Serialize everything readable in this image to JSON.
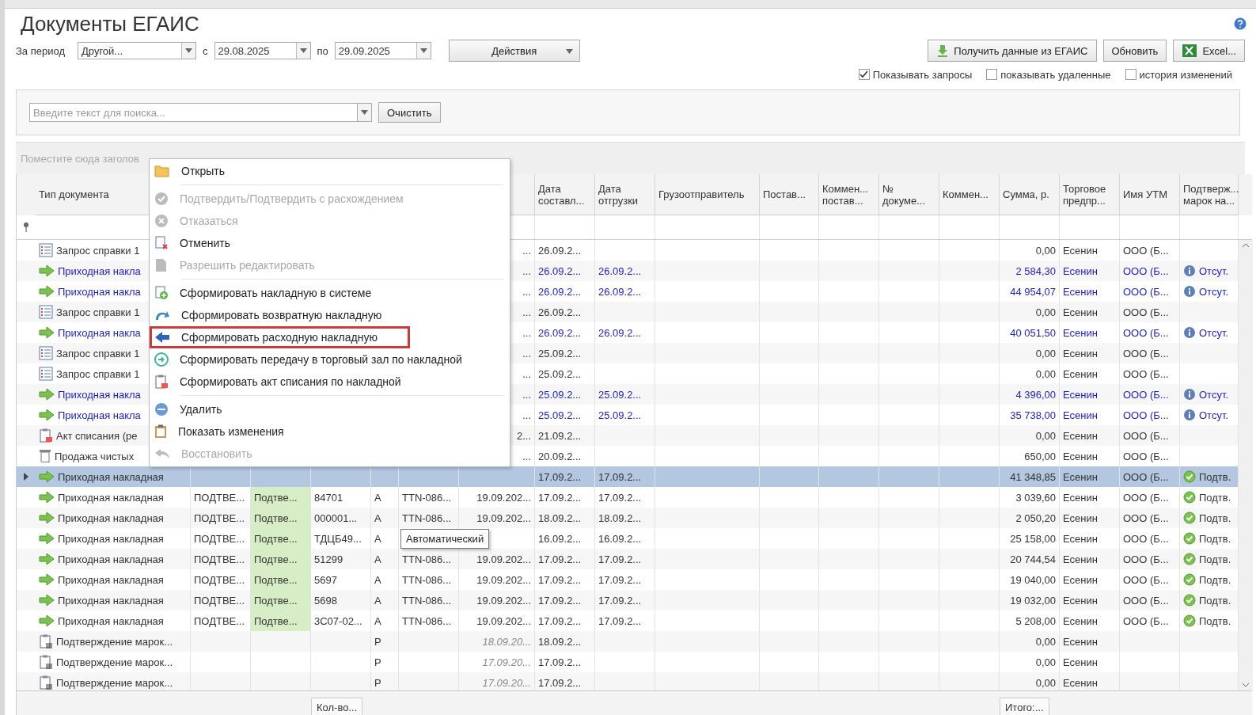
{
  "title": "Документы ЕГАИС",
  "filters": {
    "period_label": "За период",
    "period": "Другой...",
    "from_label": "с",
    "from": "29.08.2025",
    "to_label": "по",
    "to": "29.09.2025",
    "actions": "Действия"
  },
  "buttons": [
    {
      "kind": "egais",
      "label": "Получить данные из ЕГАИС"
    },
    {
      "kind": "plain",
      "label": "Обновить"
    },
    {
      "kind": "excel",
      "label": "Excel..."
    }
  ],
  "options": [
    {
      "label": "Показывать запросы",
      "checked": true
    },
    {
      "label": "показывать удаленные",
      "checked": false
    },
    {
      "label": "история изменений",
      "checked": false
    }
  ],
  "search": {
    "placeholder": "Введите текст для поиска...",
    "clear": "Очистить"
  },
  "group_panel": "Поместите сюда заголов",
  "table": {
    "columns": {
      "type": "Тип документа",
      "date_made": "Дата составл...",
      "date_shipped": "Дата отгрузки",
      "shipper": "Грузоотправитель",
      "supplier": "Постав...",
      "supplier_comment": "Коммен... постав...",
      "doc_number": "№ докуме...",
      "comment": "Коммен...",
      "sum": "Сумма, р.",
      "trade": "Торговое предпр...",
      "utm": "Имя УТМ",
      "marks": "Подтверж... марок на..."
    },
    "rows": [
      {
        "kind": "request",
        "color": "#333333",
        "selected": false,
        "cells": {
          "type": "Запрос справки 1",
          "column_8": "...",
          "date_made": "26.09.2...",
          "sum": "0,00",
          "trade": "Есенин",
          "utm": "ООО (Б..."
        }
      },
      {
        "kind": "incoming",
        "color": "#1c1ccc",
        "selected": false,
        "cells": {
          "type": "Приходная накла",
          "column_8": "...",
          "date_made": "26.09.2...",
          "date_shipped": "26.09.2...",
          "sum": "2 584,30",
          "trade": "Есенин",
          "utm": "ООО (Б..."
        },
        "confirm": {
          "kind": "info",
          "text": "Отсут."
        }
      },
      {
        "kind": "incoming",
        "color": "#1c1ccc",
        "selected": false,
        "cells": {
          "type": "Приходная накла",
          "column_8": "...",
          "date_made": "26.09.2...",
          "date_shipped": "26.09.2...",
          "sum": "44 954,07",
          "trade": "Есенин",
          "utm": "ООО (Б..."
        },
        "confirm": {
          "kind": "info",
          "text": "Отсут."
        }
      },
      {
        "kind": "request",
        "color": "#333333",
        "selected": false,
        "cells": {
          "type": "Запрос справки 1",
          "column_8": "...",
          "date_made": "26.09.2...",
          "sum": "0,00",
          "trade": "Есенин",
          "utm": "ООО (Б..."
        }
      },
      {
        "kind": "incoming",
        "color": "#1c1ccc",
        "selected": false,
        "cells": {
          "type": "Приходная накла",
          "column_8": "...",
          "date_made": "26.09.2...",
          "date_shipped": "26.09.2...",
          "sum": "40 051,50",
          "trade": "Есенин",
          "utm": "ООО (Б..."
        },
        "confirm": {
          "kind": "info",
          "text": "Отсут."
        }
      },
      {
        "kind": "request",
        "color": "#333333",
        "selected": false,
        "cells": {
          "type": "Запрос справки 1",
          "column_8": "...",
          "date_made": "25.09.2...",
          "sum": "0,00",
          "trade": "Есенин",
          "utm": "ООО (Б..."
        }
      },
      {
        "kind": "request",
        "color": "#333333",
        "selected": false,
        "cells": {
          "type": "Запрос справки 1",
          "column_8": "...",
          "date_made": "25.09.2...",
          "sum": "0,00",
          "trade": "Есенин",
          "utm": "ООО (Б..."
        }
      },
      {
        "kind": "incoming",
        "color": "#1c1ccc",
        "selected": false,
        "cells": {
          "type": "Приходная накла",
          "column_8": "...",
          "date_made": "25.09.2...",
          "date_shipped": "25.09.2...",
          "sum": "4 396,00",
          "trade": "Есенин",
          "utm": "ООО (Б..."
        },
        "confirm": {
          "kind": "info",
          "text": "Отсут."
        }
      },
      {
        "kind": "incoming",
        "color": "#1c1ccc",
        "selected": false,
        "cells": {
          "type": "Приходная накла",
          "column_8": "...",
          "date_made": "25.09.2...",
          "date_shipped": "25.09.2...",
          "sum": "35 738,00",
          "trade": "Есенин",
          "utm": "ООО (Б..."
        },
        "confirm": {
          "kind": "info",
          "text": "Отсут."
        }
      },
      {
        "kind": "writeoff",
        "color": "#333333",
        "selected": false,
        "cells": {
          "type": "Акт списания (ре",
          "column_8": "2...",
          "date_made": "21.09.2...",
          "sum": "0,00",
          "trade": "Есенин",
          "utm": "ООО (Б..."
        }
      },
      {
        "kind": "sale",
        "color": "#333333",
        "selected": false,
        "cells": {
          "type": "Продажа чистых",
          "column_8": "...",
          "date_made": "20.09.2...",
          "sum": "650,00",
          "trade": "Есенин",
          "utm": "ООО (Б..."
        }
      },
      {
        "kind": "incoming",
        "color": "#333333",
        "selected": true,
        "cells": {
          "type": "Приходная накладная",
          "date_made": "17.09.2...",
          "date_shipped": "17.09.2...",
          "sum": "41 348,85",
          "trade": "Есенин",
          "utm": "ООО (Б..."
        },
        "confirm": {
          "kind": "ok",
          "text": "Подтв."
        }
      },
      {
        "kind": "incoming",
        "color": "#333333",
        "selected": false,
        "cells": {
          "type": "Приходная накладная",
          "column_3": "ПОДТВЕ...",
          "column_4": "Подтве...",
          "column_5": "84701",
          "column_6": "A",
          "column_7": "TTN-086...",
          "column_8": "19.09.202...",
          "date_made": "17.09.2...",
          "date_shipped": "17.09.2...",
          "sum": "3 039,60",
          "trade": "Есенин",
          "utm": "ООО (Б..."
        },
        "confirm": {
          "kind": "ok",
          "text": "Подтв."
        }
      },
      {
        "kind": "incoming",
        "color": "#333333",
        "selected": false,
        "cells": {
          "type": "Приходная накладная",
          "column_3": "ПОДТВЕ...",
          "column_4": "Подтве...",
          "column_5": "000001...",
          "column_6": "A",
          "column_7": "TTN-086...",
          "column_8": "19.09.202...",
          "date_made": "18.09.2...",
          "date_shipped": "18.09.2...",
          "sum": "2 050,20",
          "trade": "Есенин",
          "utm": "ООО (Б..."
        },
        "confirm": {
          "kind": "ok",
          "text": "Подтв."
        }
      },
      {
        "kind": "incoming",
        "color": "#333333",
        "selected": false,
        "cells": {
          "type": "Приходная накладная",
          "column_3": "ПОДТВЕ...",
          "column_4": "Подтве...",
          "column_5": "ТДЦБ49...",
          "column_6": "A",
          "date_made": "16.09.2...",
          "date_shipped": "16.09.2...",
          "sum": "25 158,00",
          "trade": "Есенин",
          "utm": "ООО (Б..."
        },
        "confirm": {
          "kind": "ok",
          "text": "Подтв."
        }
      },
      {
        "kind": "incoming",
        "color": "#333333",
        "selected": false,
        "cells": {
          "type": "Приходная накладная",
          "column_3": "ПОДТВЕ...",
          "column_4": "Подтве...",
          "column_5": "51299",
          "column_6": "A",
          "column_7": "TTN-086...",
          "column_8": "19.09.202...",
          "date_made": "17.09.2...",
          "date_shipped": "17.09.2...",
          "sum": "20 744,54",
          "trade": "Есенин",
          "utm": "ООО (Б..."
        },
        "confirm": {
          "kind": "ok",
          "text": "Подтв."
        }
      },
      {
        "kind": "incoming",
        "color": "#333333",
        "selected": false,
        "cells": {
          "type": "Приходная накладная",
          "column_3": "ПОДТВЕ...",
          "column_4": "Подтве...",
          "column_5": "5697",
          "column_6": "A",
          "column_7": "TTN-086...",
          "column_8": "19.09.202...",
          "date_made": "17.09.2...",
          "date_shipped": "17.09.2...",
          "sum": "19 040,00",
          "trade": "Есенин",
          "utm": "ООО (Б..."
        },
        "confirm": {
          "kind": "ok",
          "text": "Подтв."
        }
      },
      {
        "kind": "incoming",
        "color": "#333333",
        "selected": false,
        "cells": {
          "type": "Приходная накладная",
          "column_3": "ПОДТВЕ...",
          "column_4": "Подтве...",
          "column_5": "5698",
          "column_6": "A",
          "column_7": "TTN-086...",
          "column_8": "19.09.202...",
          "date_made": "17.09.2...",
          "date_shipped": "17.09.2...",
          "sum": "19 032,00",
          "trade": "Есенин",
          "utm": "ООО (Б..."
        },
        "confirm": {
          "kind": "ok",
          "text": "Подтв."
        }
      },
      {
        "kind": "incoming",
        "color": "#333333",
        "selected": false,
        "cells": {
          "type": "Приходная накладная",
          "column_3": "ПОДТВЕ...",
          "column_4": "Подтве...",
          "column_5": "3C07-02...",
          "column_6": "A",
          "column_7": "TTN-086...",
          "column_8": "19.09.202...",
          "date_made": "17.09.2...",
          "date_shipped": "17.09.2...",
          "sum": "5 208,00",
          "trade": "Есенин",
          "utm": "ООО (Б..."
        },
        "confirm": {
          "kind": "ok",
          "text": "Подтв."
        }
      },
      {
        "kind": "marks",
        "color": "#333333",
        "selected": false,
        "cells": {
          "type": "Подтверждение марок...",
          "column_6": "P",
          "column_8": "18.09.20...",
          "date_made": "18.09.2...",
          "sum": "0,00",
          "trade": "Есенин"
        }
      },
      {
        "kind": "marks",
        "color": "#333333",
        "selected": false,
        "cells": {
          "type": "Подтверждение марок...",
          "column_6": "P",
          "column_8": "17.09.20...",
          "date_made": "17.09.2...",
          "sum": "0,00",
          "trade": "Есенин"
        }
      },
      {
        "kind": "marks",
        "color": "#333333",
        "selected": false,
        "cells": {
          "type": "Подтверждение марок...",
          "column_6": "P",
          "column_8": "17.09.20...",
          "date_made": "17.09.2...",
          "sum": "0,00",
          "trade": "Есенин"
        }
      }
    ],
    "footer": {
      "count": "Кол-во...",
      "total": "Итого:..."
    }
  },
  "tooltip": {
    "text": "Автоматический"
  },
  "context_menu": {
    "groups": [
      [
        {
          "kind": "open",
          "label": "Открыть",
          "disabled": false,
          "selected": false
        }
      ],
      [
        {
          "kind": "confirm",
          "label": "Подтвердить/Подтвердить с расхождением",
          "disabled": true,
          "selected": false
        },
        {
          "kind": "refuse",
          "label": "Отказаться",
          "disabled": true,
          "selected": false
        },
        {
          "kind": "cancel",
          "label": "Отменить",
          "disabled": false,
          "selected": false
        },
        {
          "kind": "edit",
          "label": "Разрешить редактировать",
          "disabled": true,
          "selected": false
        }
      ],
      [
        {
          "kind": "create",
          "label": "Сформировать накладную в системе",
          "disabled": false,
          "selected": false
        },
        {
          "kind": "return",
          "label": "Сформировать возвратную накладную",
          "disabled": false,
          "selected": false
        },
        {
          "kind": "expense",
          "label": "Сформировать расходную накладную",
          "disabled": false,
          "selected": true
        },
        {
          "kind": "transfer",
          "label": "Сформировать передачу в торговый зал по накладной",
          "disabled": false,
          "selected": false
        },
        {
          "kind": "writeoff",
          "label": "Сформировать акт списания по накладной",
          "disabled": false,
          "selected": false
        }
      ],
      [
        {
          "kind": "delete",
          "label": "Удалить",
          "disabled": false,
          "selected": false
        },
        {
          "kind": "history",
          "label": "Показать изменения",
          "disabled": false,
          "selected": false
        },
        {
          "kind": "restore",
          "label": "Восстановить",
          "disabled": true,
          "selected": false
        }
      ]
    ]
  }
}
